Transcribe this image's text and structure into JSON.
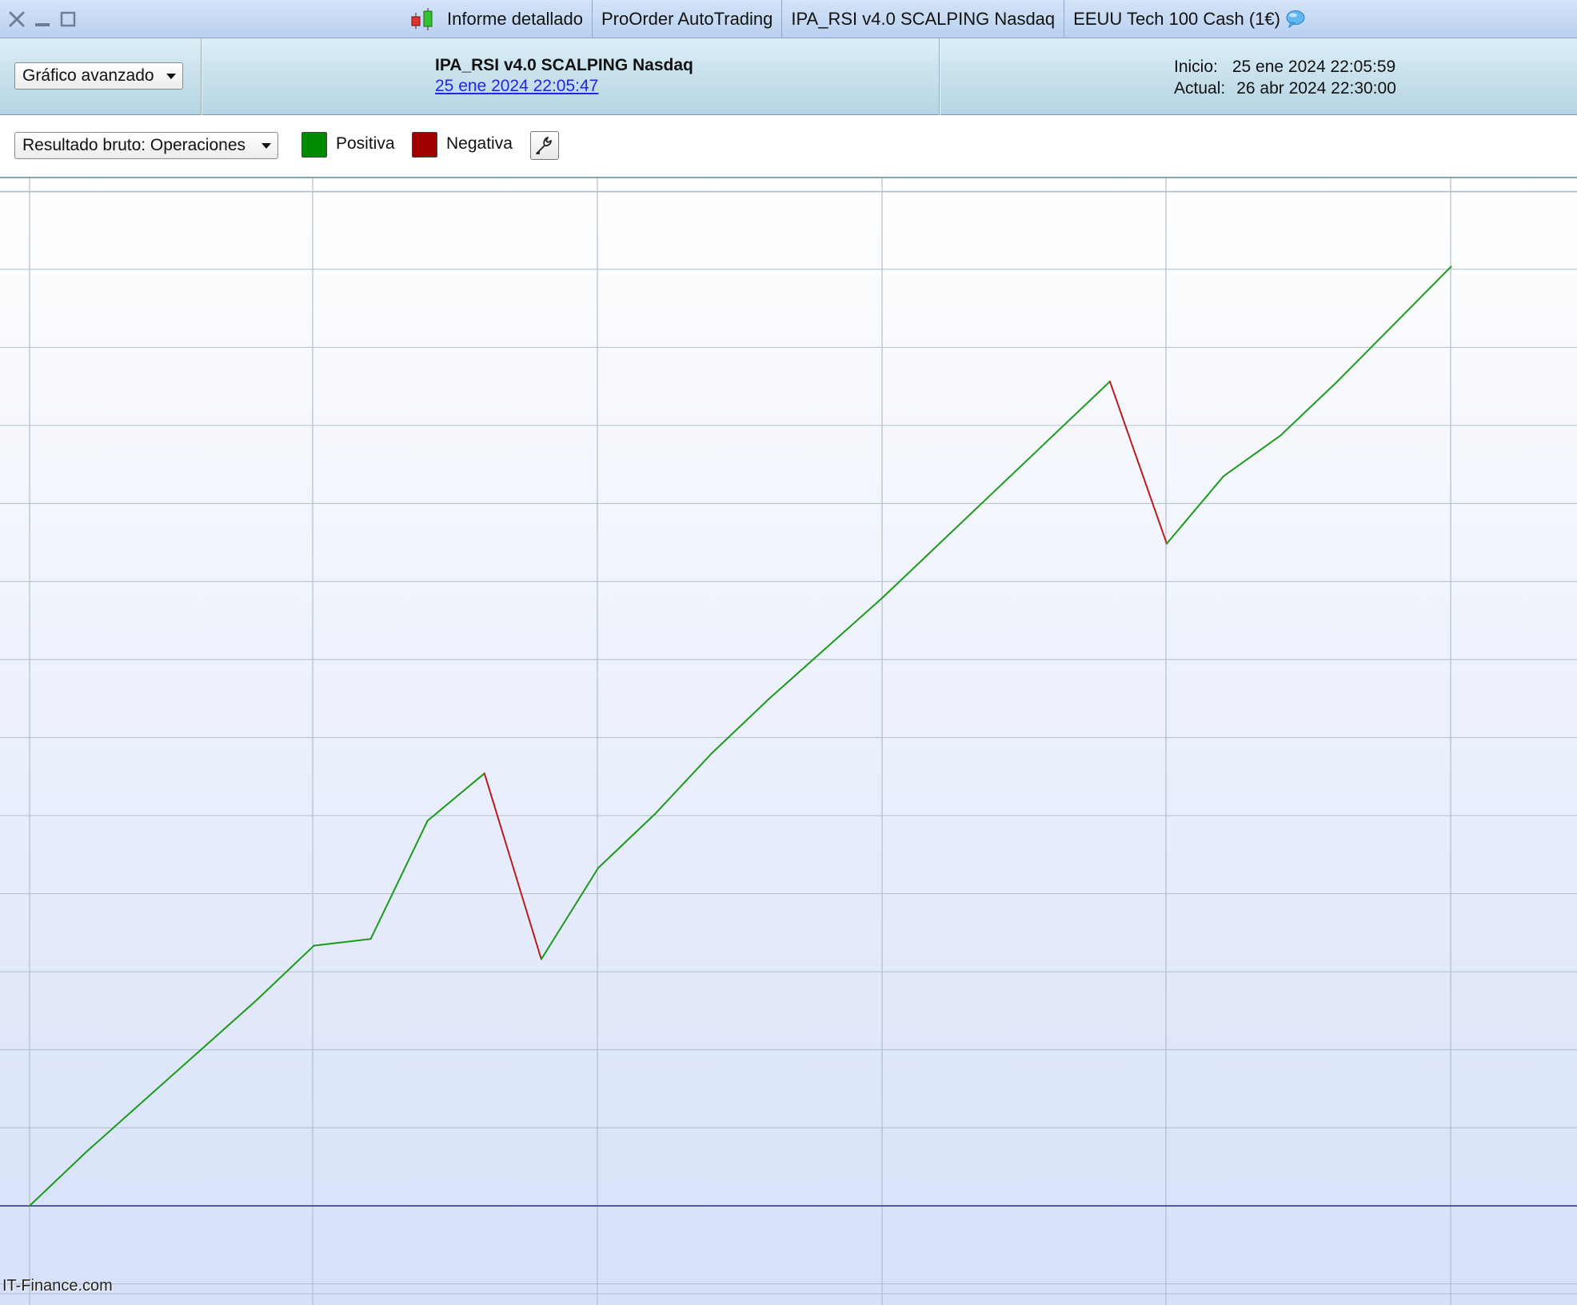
{
  "window": {
    "close_icon": "x-icon",
    "minimize_icon": "minimize-icon",
    "maximize_icon": "maximize-icon"
  },
  "tabs": [
    {
      "label": "Informe detallado",
      "icon": "candlestick-icon"
    },
    {
      "label": "ProOrder AutoTrading"
    },
    {
      "label": "IPA_RSI v4.0 SCALPING Nasdaq"
    },
    {
      "label": "EEUU Tech 100 Cash (1€)",
      "icon": "speech-bubble-icon"
    }
  ],
  "header": {
    "chart_mode": "Gráfico avanzado",
    "strategy_name": "IPA_RSI v4.0 SCALPING Nasdaq",
    "strategy_date": "25 ene 2024 22:05:47",
    "start_label": "Inicio:",
    "start_value": "25 ene 2024 22:05:59",
    "current_label": "Actual:",
    "current_value": "26 abr 2024 22:30:00"
  },
  "toolbar": {
    "result_mode": "Resultado bruto: Operaciones",
    "positive_label": "Positiva",
    "negative_label": "Negativa",
    "positive_color": "#008c00",
    "negative_color": "#a00000",
    "settings_icon": "wrench-icon"
  },
  "watermark": "IT-Finance.com",
  "colors": {
    "positive_line": "#1c9a1c",
    "negative_line": "#b81c1c",
    "zero_line": "#2a2a8a",
    "grid": "#aebfcc"
  },
  "chart_data": {
    "type": "line",
    "title": "",
    "xlabel": "",
    "ylabel": "",
    "grid": true,
    "x": [
      0,
      1,
      2,
      3,
      4,
      5,
      6,
      7,
      8,
      9,
      10,
      11,
      12,
      13,
      14,
      15,
      16,
      17,
      18,
      19,
      20,
      21,
      22,
      23,
      24,
      25
    ],
    "values": [
      0,
      0.8,
      1.55,
      2.3,
      3.05,
      3.85,
      3.95,
      5.7,
      6.4,
      3.65,
      5.0,
      5.8,
      6.7,
      7.5,
      8.25,
      9.0,
      9.8,
      10.6,
      11.4,
      12.2,
      9.8,
      10.8,
      11.4,
      12.2,
      13.05,
      13.9
    ],
    "segment_colors": [
      "positive",
      "positive",
      "positive",
      "positive",
      "positive",
      "positive",
      "positive",
      "positive",
      "negative",
      "positive",
      "positive",
      "positive",
      "positive",
      "positive",
      "positive",
      "positive",
      "positive",
      "positive",
      "positive",
      "negative",
      "positive",
      "positive",
      "positive",
      "positive",
      "positive"
    ],
    "baseline": 0
  }
}
